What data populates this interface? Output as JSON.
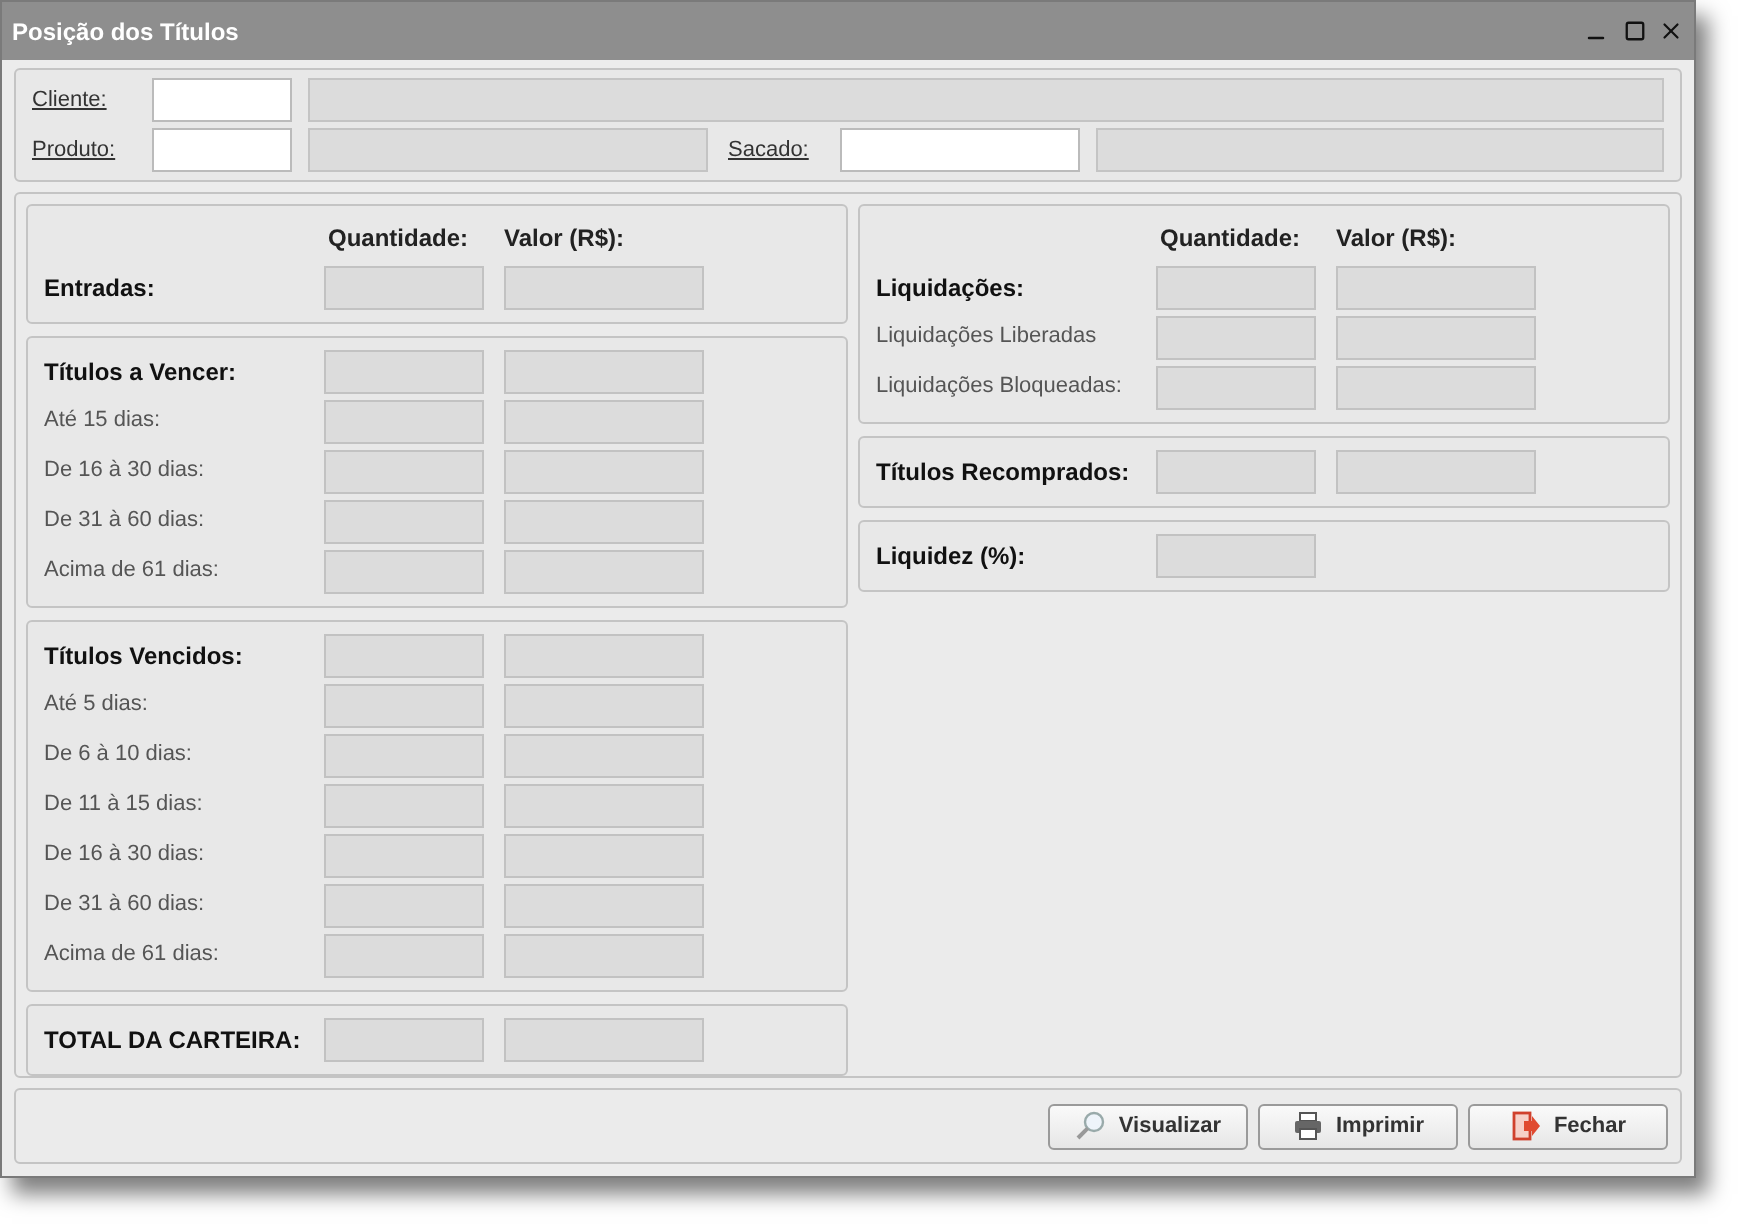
{
  "window": {
    "title": "Posição dos Títulos"
  },
  "filters": [
    [
      {
        "label": "Cliente:",
        "kind": "wide"
      }
    ],
    [
      {
        "label": "Produto:",
        "kind": "short"
      },
      {
        "label": "Sacado:",
        "kind": "wide"
      }
    ]
  ],
  "left_column": [
    {
      "column_headers": [
        "Quantidade:",
        "Valor (R$):"
      ],
      "rows": [
        {
          "label": "Entradas:",
          "kind": "heading",
          "value_field": true
        }
      ]
    },
    {
      "rows": [
        {
          "label": "Títulos a Vencer:",
          "kind": "heading",
          "value_field": true
        },
        {
          "label": "Até 15 dias:",
          "kind": "detail",
          "value_field": true
        },
        {
          "label": "De 16 à 30 dias:",
          "kind": "detail",
          "value_field": true
        },
        {
          "label": "De 31 à 60 dias:",
          "kind": "detail",
          "value_field": true
        },
        {
          "label": "Acima de 61 dias:",
          "kind": "detail",
          "value_field": true
        }
      ]
    },
    {
      "rows": [
        {
          "label": "Títulos Vencidos:",
          "kind": "heading",
          "value_field": true
        },
        {
          "label": "Até 5 dias:",
          "kind": "detail",
          "value_field": true
        },
        {
          "label": "De 6 à 10 dias:",
          "kind": "detail",
          "value_field": true
        },
        {
          "label": "De 11 à 15 dias:",
          "kind": "detail",
          "value_field": true
        },
        {
          "label": "De 16 à 30 dias:",
          "kind": "detail",
          "value_field": true
        },
        {
          "label": "De 31 à 60 dias:",
          "kind": "detail",
          "value_field": true
        },
        {
          "label": "Acima de 61 dias:",
          "kind": "detail",
          "value_field": true
        }
      ]
    },
    {
      "rows": [
        {
          "label": "TOTAL DA CARTEIRA:",
          "kind": "heading",
          "value_field": true
        }
      ]
    }
  ],
  "right_column": [
    {
      "column_headers": [
        "Quantidade:",
        "Valor (R$):"
      ],
      "rows": [
        {
          "label": "Liquidações:",
          "kind": "heading",
          "value_field": true
        },
        {
          "label": "Liquidações Liberadas",
          "kind": "detail",
          "value_field": true
        },
        {
          "label": "Liquidações Bloqueadas:",
          "kind": "detail",
          "value_field": true
        }
      ]
    },
    {
      "rows": [
        {
          "label": "Títulos Recomprados:",
          "kind": "heading",
          "value_field": true
        }
      ]
    },
    {
      "rows": [
        {
          "label": "Liquidez (%):",
          "kind": "heading",
          "value_field": false
        }
      ]
    }
  ],
  "buttons": [
    "Visualizar",
    "Imprimir",
    "Fechar"
  ]
}
